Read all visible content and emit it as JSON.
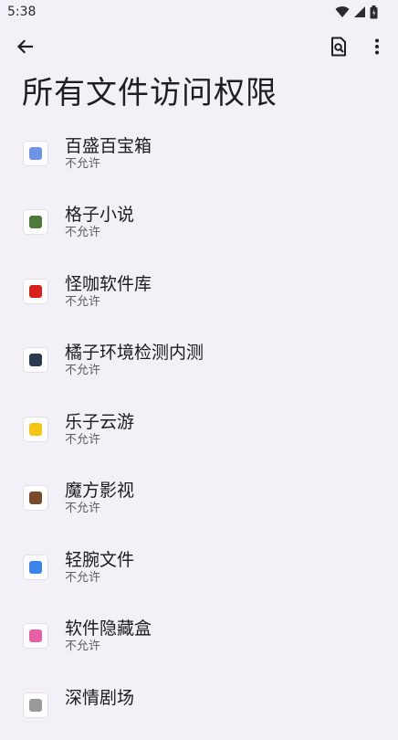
{
  "status_bar": {
    "time": "5:38",
    "icons": [
      "wifi-icon",
      "signal-icon",
      "battery-icon"
    ]
  },
  "toolbar": {
    "back_icon": "arrow-left-icon",
    "search_icon": "search-in-page-icon",
    "more_icon": "more-vert-icon"
  },
  "page": {
    "title": "所有文件访问权限"
  },
  "apps": [
    {
      "name": "百盛百宝箱",
      "status": "不允许",
      "icon": "app-baisheng-icon",
      "color": "#6f93e6"
    },
    {
      "name": "格子小说",
      "status": "不允许",
      "icon": "app-gezi-icon",
      "color": "#4f7b3a"
    },
    {
      "name": "怪咖软件库",
      "status": "不允许",
      "icon": "app-guaika-icon",
      "color": "#d8211b"
    },
    {
      "name": "橘子环境检测内测",
      "status": "不允许",
      "icon": "app-juzi-icon",
      "color": "#2a3a4f"
    },
    {
      "name": "乐子云游",
      "status": "不允许",
      "icon": "app-lezi-icon",
      "color": "#f5c516"
    },
    {
      "name": "魔方影视",
      "status": "不允许",
      "icon": "app-mofang-icon",
      "color": "#7a4b2a"
    },
    {
      "name": "轻腕文件",
      "status": "不允许",
      "icon": "app-qingwan-icon",
      "color": "#3a83e8"
    },
    {
      "name": "软件隐藏盒",
      "status": "不允许",
      "icon": "app-yincang-icon",
      "color": "#e85fa6"
    },
    {
      "name": "深情剧场",
      "status": "",
      "icon": "app-shenqing-icon",
      "color": "#999999"
    }
  ]
}
